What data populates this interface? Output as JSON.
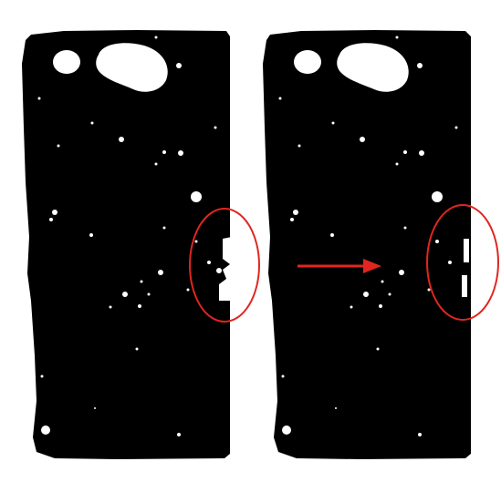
{
  "colors": {
    "background": "#ffffff",
    "mask": "#000000",
    "speckle": "#ffffff",
    "annotation": "#e0261f"
  },
  "panels": [
    {
      "label": "",
      "variant": "before"
    },
    {
      "label": "",
      "variant": "after"
    }
  ],
  "annotations": {
    "highlight_shape": "ellipse",
    "pointer_shape": "arrow"
  }
}
